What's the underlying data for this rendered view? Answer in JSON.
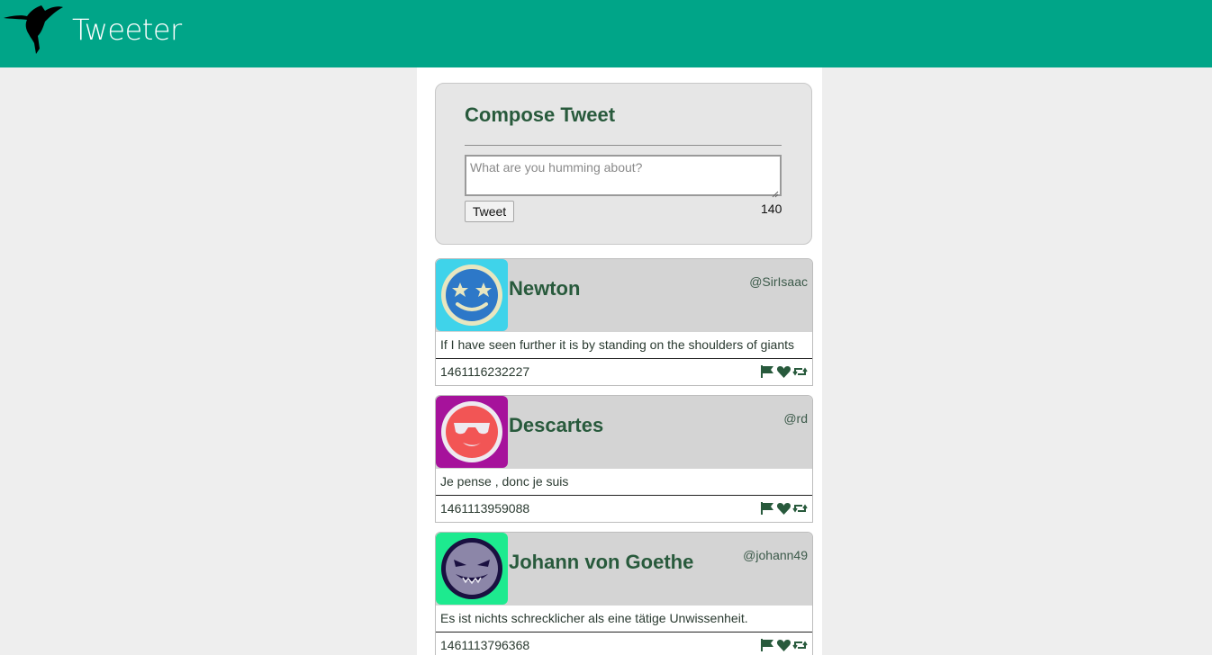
{
  "app": {
    "title": "Tweeter",
    "logo_icon": "hummingbird-icon",
    "brand_color": "#00a588"
  },
  "compose": {
    "title": "Compose Tweet",
    "placeholder": "What are you humming about?",
    "value": "",
    "button_label": "Tweet",
    "counter": "140"
  },
  "tweets": [
    {
      "name": "Newton",
      "handle": "@SirIsaac",
      "text": "If I have seen further it is by standing on the shoulders of giants",
      "timestamp": "1461116232227",
      "avatar_icon": "star-eyes-face-icon",
      "avatar_bg": "#3fd3ea",
      "actions": [
        "flag-icon",
        "heart-icon",
        "retweet-icon"
      ]
    },
    {
      "name": "Descartes",
      "handle": "@rd",
      "text": "Je pense , donc je suis",
      "timestamp": "1461113959088",
      "avatar_icon": "sunglasses-face-icon",
      "avatar_bg": "#a6129b",
      "actions": [
        "flag-icon",
        "heart-icon",
        "retweet-icon"
      ]
    },
    {
      "name": "Johann von Goethe",
      "handle": "@johann49",
      "text": "Es ist nichts schrecklicher als eine tätige Unwissenheit.",
      "timestamp": "1461113796368",
      "avatar_icon": "evil-grin-face-icon",
      "avatar_bg": "#1dea8f",
      "actions": [
        "flag-icon",
        "heart-icon",
        "retweet-icon"
      ]
    }
  ]
}
